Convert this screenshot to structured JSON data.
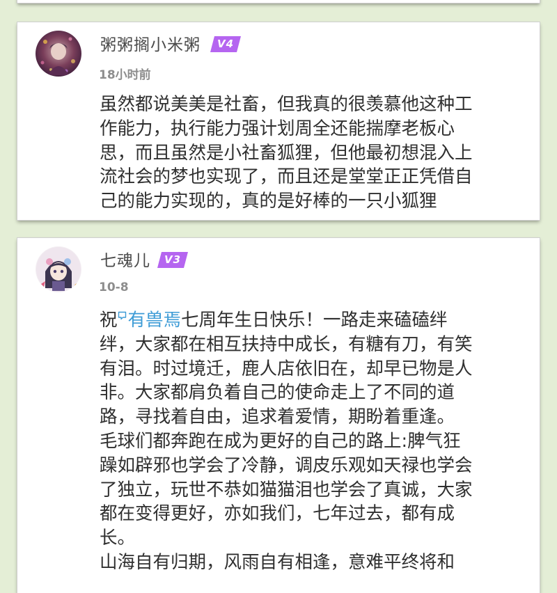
{
  "comments": [
    {
      "username": "粥粥搁小米粥",
      "level": "V4",
      "time": "18小时前",
      "lines": [
        "虽然都说美美是社畜，但我真的很羡慕他这种工",
        "作能力，执行能力强计划周全还能揣摩老板心",
        "思，而且虽然是小社畜狐狸，但他最初想混入上",
        "流社会的梦也实现了，而且还是堂堂正正凭借自",
        "己的能力实现的，真的是好棒的一只小狐狸"
      ]
    },
    {
      "username": "七魂儿",
      "level": "V3",
      "time": "10-8",
      "first_prefix": "祝",
      "mention": "有兽焉",
      "first_suffix": "七周年生日快乐！一路走来磕磕绊",
      "lines": [
        "绊，大家都在相互扶持中成长，有糖有刀，有笑",
        "有泪。时过境迁，鹿人店依旧在，却早已物是人",
        "非。大家都肩负着自己的使命走上了不同的道",
        "路，寻找着自由，追求着爱情，期盼着重逢。",
        "毛球们都奔跑在成为更好的自己的路上:脾气狂",
        "躁如辟邪也学会了冷静，调皮乐观如天禄也学会",
        "了独立，玩世不恭如猫猫泪也学会了真诚，大家",
        "都在变得更好，亦如我们，七年过去，都有成",
        "长。",
        "山海自有归期，风雨自有相逢，意难平终将和"
      ]
    }
  ],
  "colors": {
    "background": "#e4eed6",
    "badge": "#b565f0",
    "mention": "#3c9bd6"
  },
  "icons": {
    "mention": "mention-icon"
  }
}
